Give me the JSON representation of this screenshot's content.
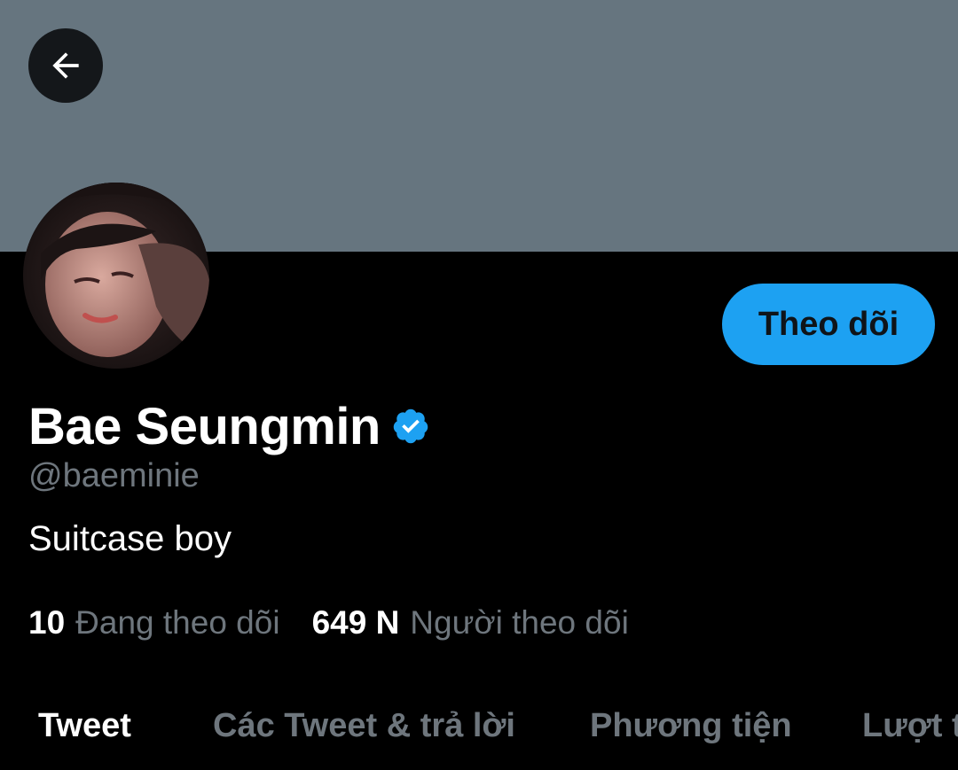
{
  "header": {
    "back_icon": "arrow-left-icon",
    "banner_color": "#66757f"
  },
  "profile": {
    "avatar": "profile-photo",
    "follow_label": "Theo dõi",
    "display_name": "Bae Seungmin",
    "verified_icon": "verified-badge-icon",
    "handle": "@baeminie",
    "bio": "Suitcase boy",
    "following_count": "10",
    "following_label": "Đang theo dõi",
    "followers_count": "649 N",
    "followers_label": "Người theo dõi"
  },
  "tabs": [
    {
      "label": "Tweet",
      "active": true
    },
    {
      "label": "Các Tweet & trả lời",
      "active": false
    },
    {
      "label": "Phương tiện",
      "active": false
    },
    {
      "label": "Lượt thích",
      "active": false
    }
  ],
  "colors": {
    "accent": "#1da1f2",
    "background": "#000000",
    "muted_text": "#6e767d"
  }
}
